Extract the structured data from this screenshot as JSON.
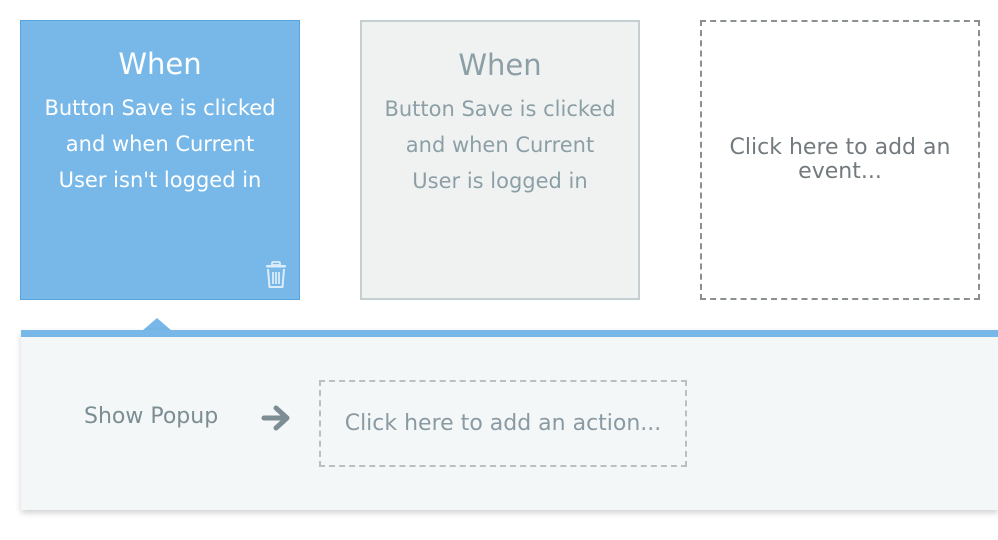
{
  "events": [
    {
      "title": "When",
      "line1": "Button Save is clicked",
      "line2": "and when Current",
      "line3": "User isn't logged in",
      "state": "selected"
    },
    {
      "title": "When",
      "line1": "Button Save is clicked",
      "line2": "and when Current",
      "line3": "User is logged in",
      "state": "unselected"
    }
  ],
  "add_event": {
    "label": "Click here to add an event..."
  },
  "actions": {
    "items": [
      {
        "label": "Show Popup"
      }
    ],
    "add_action_label": "Click here to add an action..."
  },
  "icons": {
    "delete": "trash-icon",
    "arrow": "arrow-right-icon"
  },
  "colors": {
    "accent": "#77b8e8",
    "selected_card_bg": "#77b8e8",
    "unselected_card_bg": "#f0f2f1",
    "panel_bg": "#f4f7f8"
  }
}
